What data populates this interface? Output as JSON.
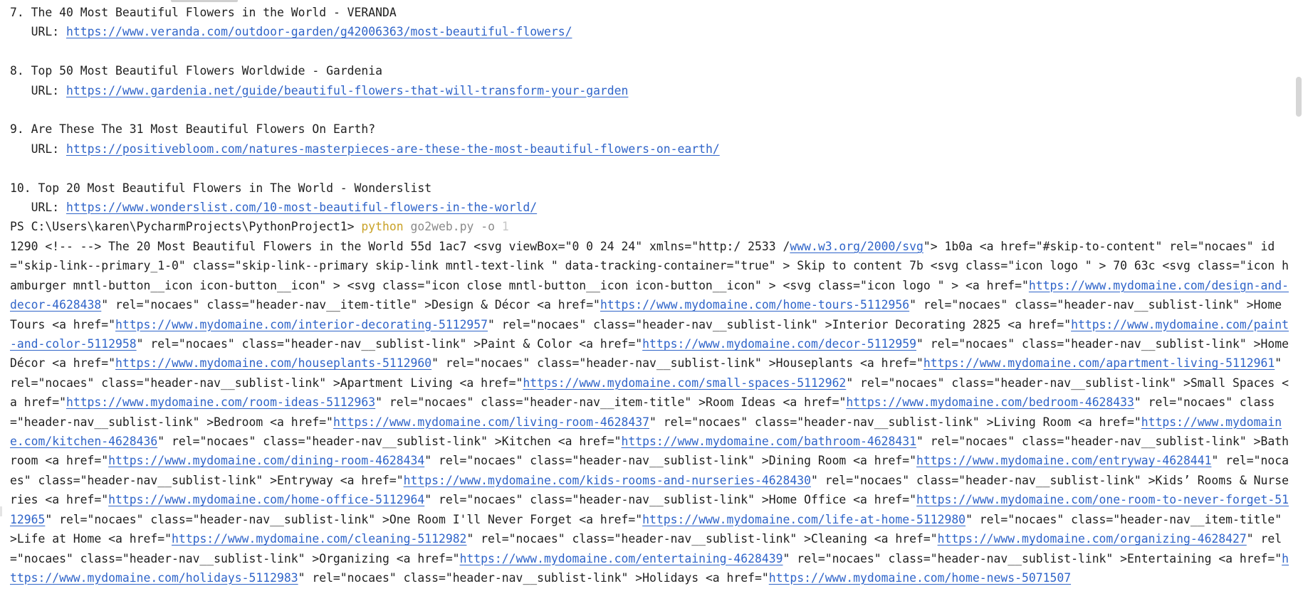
{
  "results": [
    {
      "num": "7.",
      "title": "The 40 Most Beautiful Flowers in the World - VERANDA",
      "url_label": "URL:",
      "url": "https://www.veranda.com/outdoor-garden/g42006363/most-beautiful-flowers/"
    },
    {
      "num": "8.",
      "title": "Top 50 Most Beautiful Flowers Worldwide - Gardenia",
      "url_label": "URL:",
      "url": "https://www.gardenia.net/guide/beautiful-flowers-that-will-transform-your-garden"
    },
    {
      "num": "9.",
      "title": "Are These The 31 Most Beautiful Flowers On Earth?",
      "url_label": "URL:",
      "url": "https://positivebloom.com/natures-masterpieces-are-these-the-most-beautiful-flowers-on-earth/"
    },
    {
      "num": "10.",
      "title": "Top 20 Most Beautiful Flowers in The World - Wonderslist",
      "url_label": "URL:",
      "url": "https://www.wonderslist.com/10-most-beautiful-flowers-in-the-world/"
    }
  ],
  "prompt": {
    "path": "PS C:\\Users\\karen\\PycharmProjects\\PythonProject1>",
    "command": "python",
    "script": "go2web.py -o",
    "arg": "1"
  },
  "output": [
    {
      "t": "1290 <!-- --> The 20 Most Beautiful Flowers in the World 55d 1ac7 <svg viewBox=\"0 0 24 24\" xmlns=\"http:/ 2533 /"
    },
    {
      "t": "www.w3.org/2000/svg",
      "link": true
    },
    {
      "t": "\"> 1b0a <a href=\"#skip-to-content\" rel=\"nocaes\" id=\"skip-link--primary_1-0\" class=\"skip-link--primary skip-link mntl-text-link \" data-tracking-container=\"true\" > Skip to content 7b <svg class=\"icon logo \" > 70 63c <svg class=\"icon hamburger mntl-button__icon icon-button__icon\" > <svg class=\"icon close mntl-button__icon icon-button__icon\" > <svg class=\"icon logo \" > <a href=\""
    },
    {
      "t": "https://www.mydomaine.com/design-and-decor-4628438",
      "link": true
    },
    {
      "t": "\" rel=\"nocaes\" class=\"header-nav__item-title\" >Design & Décor <a href=\""
    },
    {
      "t": "https://www.mydomaine.com/home-tours-5112956",
      "link": true
    },
    {
      "t": "\" rel=\"nocaes\" class=\"header-nav__sublist-link\" >Home Tours <a href=\""
    },
    {
      "t": "https://www.mydomaine.com/interior-decorating-5112957",
      "link": true
    },
    {
      "t": "\" rel=\"nocaes\" class=\"header-nav__sublist-link\" >Interior Decorating 2825 <a href=\""
    },
    {
      "t": "https://www.mydomaine.com/paint-and-color-5112958",
      "link": true
    },
    {
      "t": "\" rel=\"nocaes\" class=\"header-nav__sublist-link\" >Paint & Color <a href=\""
    },
    {
      "t": "https://www.mydomaine.com/decor-5112959",
      "link": true
    },
    {
      "t": "\" rel=\"nocaes\" class=\"header-nav__sublist-link\" >Home Décor <a href=\""
    },
    {
      "t": "https://www.mydomaine.com/houseplants-5112960",
      "link": true
    },
    {
      "t": "\" rel=\"nocaes\" class=\"header-nav__sublist-link\" >Houseplants <a href=\""
    },
    {
      "t": "https://www.mydomaine.com/apartment-living-5112961",
      "link": true
    },
    {
      "t": "\" rel=\"nocaes\" class=\"header-nav__sublist-link\" >Apartment Living <a href=\""
    },
    {
      "t": "https://www.mydomaine.com/small-spaces-5112962",
      "link": true
    },
    {
      "t": "\" rel=\"nocaes\" class=\"header-nav__sublist-link\" >Small Spaces <a href=\""
    },
    {
      "t": "https://www.mydomaine.com/room-ideas-5112963",
      "link": true
    },
    {
      "t": "\" rel=\"nocaes\" class=\"header-nav__item-title\" >Room Ideas <a href=\""
    },
    {
      "t": "https://www.mydomaine.com/bedroom-4628433",
      "link": true
    },
    {
      "t": "\" rel=\"nocaes\" class=\"header-nav__sublist-link\" >Bedroom <a href=\""
    },
    {
      "t": "https://www.mydomaine.com/living-room-4628437",
      "link": true
    },
    {
      "t": "\" rel=\"nocaes\" class=\"header-nav__sublist-link\" >Living Room <a href=\""
    },
    {
      "t": "https://www.mydomaine.com/kitchen-4628436",
      "link": true
    },
    {
      "t": "\" rel=\"nocaes\" class=\"header-nav__sublist-link\" >Kitchen <a href=\""
    },
    {
      "t": "https://www.mydomaine.com/bathroom-4628431",
      "link": true
    },
    {
      "t": "\" rel=\"nocaes\" class=\"header-nav__sublist-link\" >Bathroom <a href=\""
    },
    {
      "t": "https://www.mydomaine.com/dining-room-4628434",
      "link": true
    },
    {
      "t": "\" rel=\"nocaes\" class=\"header-nav__sublist-link\" >Dining Room <a href=\""
    },
    {
      "t": "https://www.mydomaine.com/entryway-4628441",
      "link": true
    },
    {
      "t": "\" rel=\"nocaes\" class=\"header-nav__sublist-link\" >Entryway <a href=\""
    },
    {
      "t": "https://www.mydomaine.com/kids-rooms-and-nurseries-4628430",
      "link": true
    },
    {
      "t": "\" rel=\"nocaes\" class=\"header-nav__sublist-link\" >Kids’ Rooms & Nurseries <a href=\""
    },
    {
      "t": "https://www.mydomaine.com/home-office-5112964",
      "link": true
    },
    {
      "t": "\" rel=\"nocaes\" class=\"header-nav__sublist-link\" >Home Office <a href=\""
    },
    {
      "t": "https://www.mydomaine.com/one-room-to-never-forget-5112965",
      "link": true
    },
    {
      "t": "\" rel=\"nocaes\" class=\"header-nav__sublist-link\" >One Room I'll Never Forget <a href=\""
    },
    {
      "t": "https://www.mydomaine.com/life-at-home-5112980",
      "link": true
    },
    {
      "t": "\" rel=\"nocaes\" class=\"header-nav__item-title\" >Life at Home <a href=\""
    },
    {
      "t": "https://www.mydomaine.com/cleaning-5112982",
      "link": true
    },
    {
      "t": "\" rel=\"nocaes\" class=\"header-nav__sublist-link\" >Cleaning <a href=\""
    },
    {
      "t": "https://www.mydomaine.com/organizing-4628427",
      "link": true
    },
    {
      "t": "\" rel=\"nocaes\" class=\"header-nav__sublist-link\" >Organizing <a href=\""
    },
    {
      "t": "https://www.mydomaine.com/entertaining-4628439",
      "link": true
    },
    {
      "t": "\" rel=\"nocaes\" class=\"header-nav__sublist-link\" >Entertaining <a href=\""
    },
    {
      "t": "https://www.mydomaine.com/holidays-5112983",
      "link": true
    },
    {
      "t": "\" rel=\"nocaes\" class=\"header-nav__sublist-link\" >Holidays <a href=\""
    },
    {
      "t": "https://www.mydomaine.com/home-news-5071507",
      "link": true
    }
  ],
  "colors": {
    "link": "#2f64c9",
    "command": "#c9a227",
    "argument": "#8a8a8a",
    "text": "#1f1f1f"
  }
}
